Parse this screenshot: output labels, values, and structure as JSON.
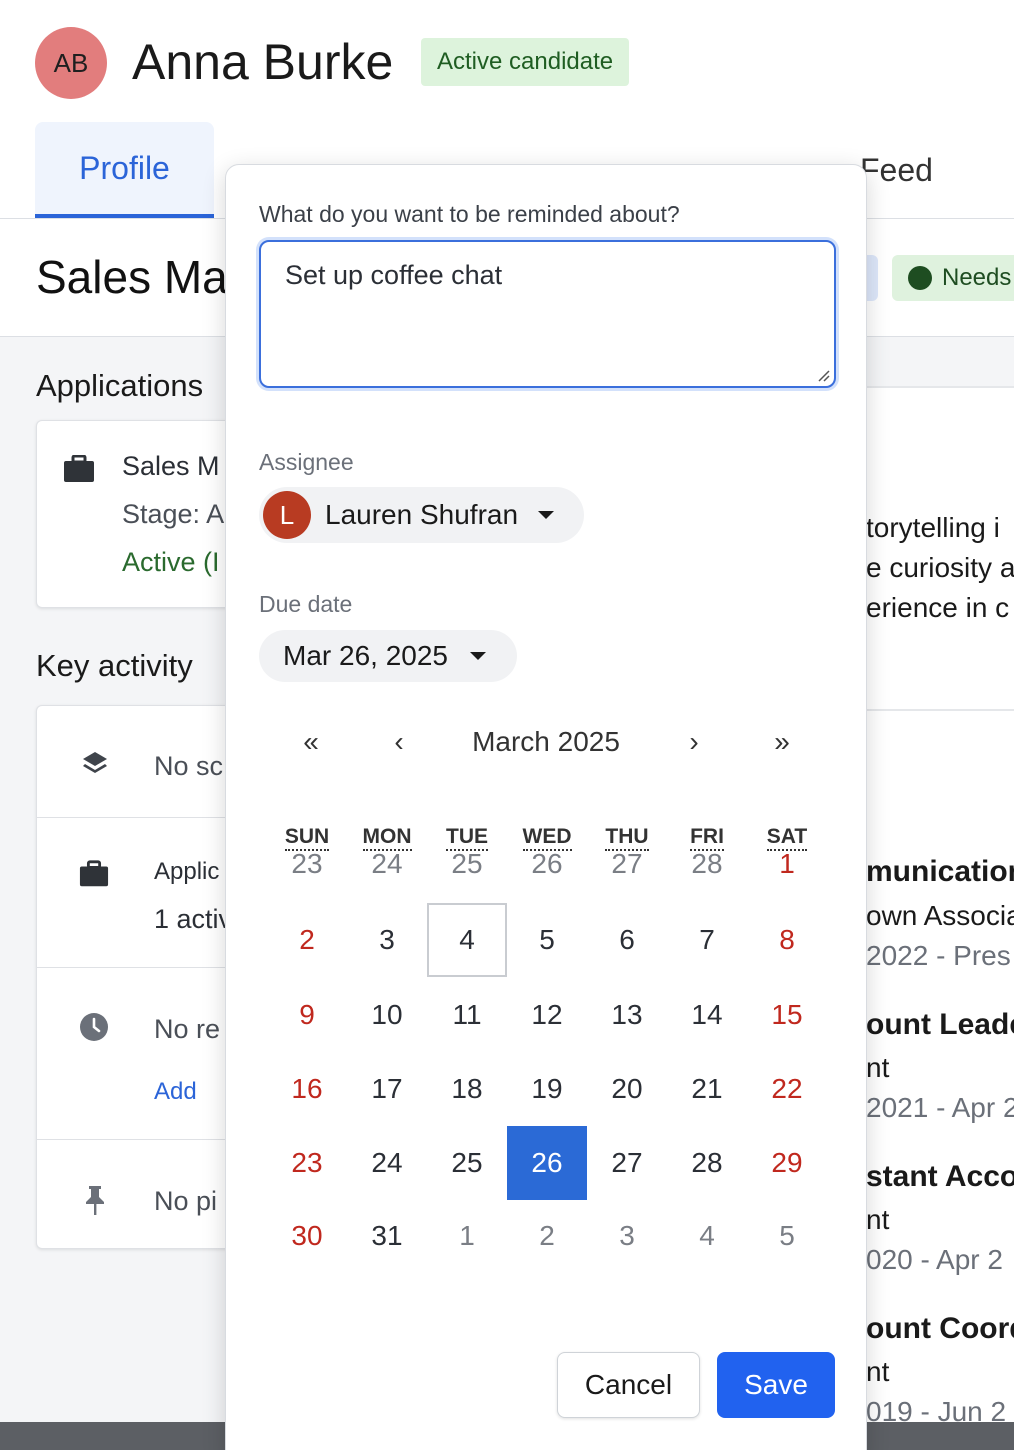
{
  "candidate": {
    "initials": "AB",
    "name": "Anna Burke",
    "status": "Active candidate",
    "avatar_color": "#e27d7d"
  },
  "tabs": [
    {
      "label": "Profile",
      "active": true
    },
    {
      "label": "Feed",
      "active": false
    }
  ],
  "page": {
    "job_title": "Sales Ma",
    "needs_label": "Needs"
  },
  "applications": {
    "title": "Applications",
    "card_title": "Sales M",
    "stage": "Stage: A",
    "status": "Active (I"
  },
  "key_activity": {
    "title": "Key activity",
    "rows": [
      {
        "icon": "layers-icon",
        "text": "No sc"
      },
      {
        "icon": "briefcase-icon",
        "line1": "Applic",
        "line2": "1 activ"
      },
      {
        "icon": "clock-icon",
        "text": "No re",
        "link": "Add"
      },
      {
        "icon": "pin-icon",
        "text": "No pi"
      }
    ]
  },
  "right_panel": {
    "summary_lines": [
      "torytelling i",
      "e curiosity a",
      "erience in c"
    ],
    "experience": [
      {
        "title": "munication",
        "org": "own Associa",
        "dates": "2022 - Pres"
      },
      {
        "title": "ount Leade",
        "org": "nt",
        "dates": "2021 - Apr 2"
      },
      {
        "title": "stant Accou",
        "org": "nt",
        "dates": "020 - Apr 2"
      },
      {
        "title": "ount Coordi",
        "org": "nt",
        "dates": "019 - Jun 2"
      }
    ]
  },
  "reminder": {
    "question_label": "What do you want to be reminded about?",
    "text": "Set up coffee chat",
    "assignee_label": "Assignee",
    "assignee": {
      "initial": "L",
      "name": "Lauren Shufran",
      "color": "#b83b22"
    },
    "due_label": "Due date",
    "due_value": "Mar 26, 2025",
    "cancel_label": "Cancel",
    "save_label": "Save",
    "accent_color": "#2162ef"
  },
  "calendar": {
    "nav": {
      "prev_year": "«",
      "prev_month": "‹",
      "next_month": "›",
      "next_year": "»"
    },
    "month_label": "March 2025",
    "weekdays": [
      "SUN",
      "MON",
      "TUE",
      "WED",
      "THU",
      "FRI",
      "SAT"
    ],
    "weeks": [
      [
        {
          "d": "23",
          "o": true
        },
        {
          "d": "24",
          "o": true
        },
        {
          "d": "25",
          "o": true
        },
        {
          "d": "26",
          "o": true
        },
        {
          "d": "27",
          "o": true
        },
        {
          "d": "28",
          "o": true
        },
        {
          "d": "1"
        }
      ],
      [
        {
          "d": "2"
        },
        {
          "d": "3"
        },
        {
          "d": "4",
          "today": true
        },
        {
          "d": "5"
        },
        {
          "d": "6"
        },
        {
          "d": "7"
        },
        {
          "d": "8"
        }
      ],
      [
        {
          "d": "9"
        },
        {
          "d": "10"
        },
        {
          "d": "11"
        },
        {
          "d": "12"
        },
        {
          "d": "13"
        },
        {
          "d": "14"
        },
        {
          "d": "15"
        }
      ],
      [
        {
          "d": "16"
        },
        {
          "d": "17"
        },
        {
          "d": "18"
        },
        {
          "d": "19"
        },
        {
          "d": "20"
        },
        {
          "d": "21"
        },
        {
          "d": "22"
        }
      ],
      [
        {
          "d": "23"
        },
        {
          "d": "24"
        },
        {
          "d": "25"
        },
        {
          "d": "26",
          "selected": true
        },
        {
          "d": "27"
        },
        {
          "d": "28"
        },
        {
          "d": "29"
        }
      ],
      [
        {
          "d": "30"
        },
        {
          "d": "31"
        },
        {
          "d": "1",
          "o": true
        },
        {
          "d": "2",
          "o": true
        },
        {
          "d": "3",
          "o": true
        },
        {
          "d": "4",
          "o": true
        },
        {
          "d": "5",
          "o": true
        }
      ]
    ]
  }
}
